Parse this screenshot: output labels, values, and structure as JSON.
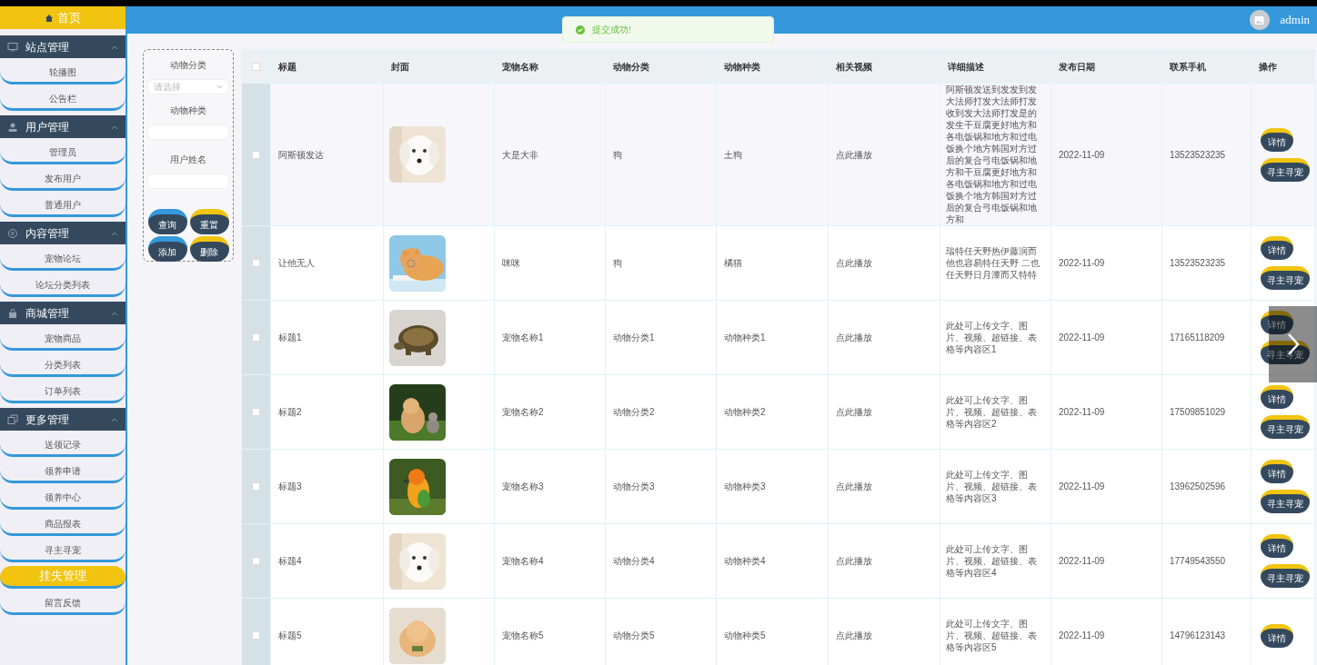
{
  "sidebar": {
    "home": "首页",
    "groups": [
      {
        "title": "站点管理",
        "expanded": true,
        "items": [
          {
            "label": "轮播图",
            "selected": false
          },
          {
            "label": "公告栏",
            "selected": false
          }
        ]
      },
      {
        "title": "用户管理",
        "expanded": true,
        "items": [
          {
            "label": "管理员",
            "selected": false
          },
          {
            "label": "发布用户",
            "selected": false
          },
          {
            "label": "普通用户",
            "selected": false
          }
        ]
      },
      {
        "title": "内容管理",
        "expanded": true,
        "items": [
          {
            "label": "宠物论坛",
            "selected": false
          },
          {
            "label": "论坛分类列表",
            "selected": false
          }
        ]
      },
      {
        "title": "商城管理",
        "expanded": true,
        "items": [
          {
            "label": "宠物商品",
            "selected": false
          },
          {
            "label": "分类列表",
            "selected": false
          },
          {
            "label": "订单列表",
            "selected": false
          }
        ]
      },
      {
        "title": "更多管理",
        "expanded": true,
        "items": [
          {
            "label": "送领记录",
            "selected": false
          },
          {
            "label": "领养申请",
            "selected": false
          },
          {
            "label": "领养中心",
            "selected": false
          },
          {
            "label": "商品报表",
            "selected": false
          },
          {
            "label": "寻主寻宠",
            "selected": false
          },
          {
            "label": "挂失管理",
            "selected": true
          },
          {
            "label": "留言反馈",
            "selected": false
          }
        ]
      }
    ]
  },
  "header": {
    "user": "admin"
  },
  "toast": {
    "message": "提交成功!"
  },
  "search": {
    "fields": [
      {
        "label": "动物分类",
        "kind": "select",
        "placeholder": "请选择"
      },
      {
        "label": "动物种类",
        "kind": "input"
      },
      {
        "label": "用户姓名",
        "kind": "input"
      }
    ],
    "buttons": [
      {
        "label": "查询",
        "color": "#3498db"
      },
      {
        "label": "重置",
        "color": "#f1c40f"
      },
      {
        "label": "添加",
        "color": "#3498db"
      },
      {
        "label": "删除",
        "color": "#f1c40f"
      }
    ]
  },
  "table": {
    "all_checked": false,
    "columns": [
      "标题",
      "封面",
      "宠物名称",
      "动物分类",
      "动物种类",
      "相关视频",
      "详细描述",
      "发布日期",
      "联系手机",
      "操作"
    ],
    "rows": [
      {
        "checked": false,
        "title": "阿斯顿发达",
        "pet": "大是大非",
        "category": "狗",
        "species": "土狗",
        "video": "点此播放",
        "desc": "阿斯顿发送到发发到发大法师打发大法师打发收到发大法师打发是的发生干豆腐更好地方和各电饭锅和地方和过电饭换个地方韩国对方过后的复合弓电饭锅和地方和干豆腐更好地方和各电饭锅和地方和过电饭换个地方韩国对方过后的复合弓电饭锅和地方和",
        "date": "2022-11-09",
        "phone": "13523523235",
        "actions": [
          "详情",
          "寻主寻宠"
        ]
      },
      {
        "checked": false,
        "title": "让他无人",
        "pet": "咪咪",
        "category": "狗",
        "species": "橘猫",
        "video": "点此播放",
        "desc": "瑞特任天野热伊藤润而他也容易特任天野 二也任天野日月潭而又特特",
        "date": "2022-11-09",
        "phone": "13523523235",
        "actions": [
          "详情",
          "寻主寻宠"
        ]
      },
      {
        "checked": false,
        "title": "标题1",
        "pet": "宠物名称1",
        "category": "动物分类1",
        "species": "动物种类1",
        "video": "点此播放",
        "desc": "此处可上传文字、图片、视频、超链接、表格等内容区1",
        "date": "2022-11-09",
        "phone": "17165118209",
        "actions": [
          "详情",
          "寻主寻宠"
        ]
      },
      {
        "checked": false,
        "title": "标题2",
        "pet": "宠物名称2",
        "category": "动物分类2",
        "species": "动物种类2",
        "video": "点此播放",
        "desc": "此处可上传文字、图片、视频、超链接、表格等内容区2",
        "date": "2022-11-09",
        "phone": "17509851029",
        "actions": [
          "详情",
          "寻主寻宠"
        ]
      },
      {
        "checked": false,
        "title": "标题3",
        "pet": "宠物名称3",
        "category": "动物分类3",
        "species": "动物种类3",
        "video": "点此播放",
        "desc": "此处可上传文字、图片、视频、超链接、表格等内容区3",
        "date": "2022-11-09",
        "phone": "13962502596",
        "actions": [
          "详情",
          "寻主寻宠"
        ]
      },
      {
        "checked": false,
        "title": "标题4",
        "pet": "宠物名称4",
        "category": "动物分类4",
        "species": "动物种类4",
        "video": "点此播放",
        "desc": "此处可上传文字、图片、视频、超链接、表格等内容区4",
        "date": "2022-11-09",
        "phone": "17749543550",
        "actions": [
          "详情",
          "寻主寻宠"
        ]
      },
      {
        "checked": false,
        "title": "标题5",
        "pet": "宠物名称5",
        "category": "动物分类5",
        "species": "动物种类5",
        "video": "点此播放",
        "desc": "此处可上传文字、图片、视频、超链接、表格等内容区5",
        "date": "2022-11-09",
        "phone": "14796123143",
        "actions": [
          "详情"
        ]
      }
    ]
  }
}
